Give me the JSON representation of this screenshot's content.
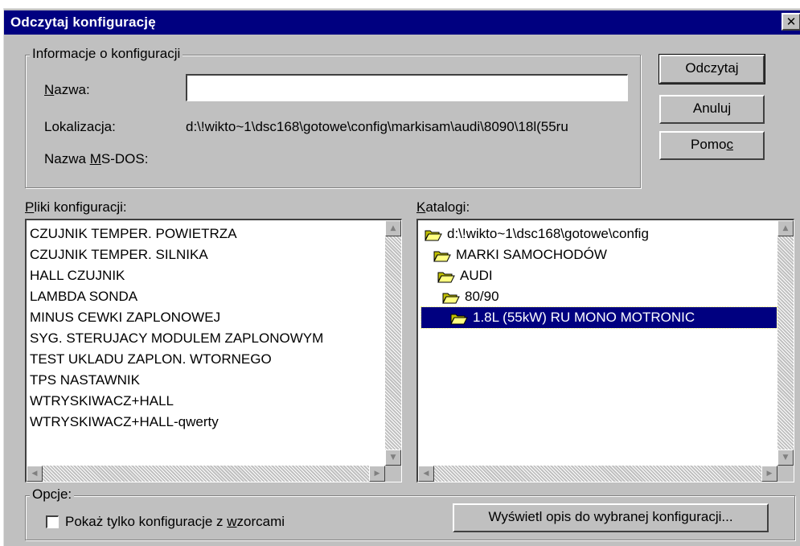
{
  "dialog": {
    "title": "Odczytaj konfigurację",
    "close_glyph": "✕"
  },
  "info_group": {
    "legend": "Informacje o konfiguracji",
    "name_label_u": "N",
    "name_label_rest": "azwa:",
    "name_value": "",
    "location_label": "Lokalizacja:",
    "location_value": "d:\\!wikto~1\\dsc168\\gotowe\\config\\markisam\\audi\\8090\\18l(55ru",
    "msdos_label_pre": "Nazwa ",
    "msdos_label_u": "M",
    "msdos_label_rest": "S-DOS:",
    "msdos_value": ""
  },
  "buttons": {
    "read": "Odczytaj",
    "cancel": "Anuluj",
    "help_pre": "Pomo",
    "help_u": "c"
  },
  "files": {
    "label_u": "P",
    "label_rest": "liki konfiguracji:",
    "items": [
      "CZUJNIK TEMPER. POWIETRZA",
      "CZUJNIK TEMPER. SILNIKA",
      "HALL CZUJNIK",
      "LAMBDA SONDA",
      "MINUS CEWKI ZAPLONOWEJ",
      "SYG. STERUJACY MODULEM ZAPLONOWYM",
      "TEST  UKLADU  ZAPLON. WTORNEGO",
      "TPS NASTAWNIK",
      "WTRYSKIWACZ+HALL",
      "WTRYSKIWACZ+HALL-qwerty"
    ]
  },
  "dirs": {
    "label_u": "K",
    "label_rest": "atalogi:",
    "items": [
      "d:\\!wikto~1\\dsc168\\gotowe\\config",
      "MARKI SAMOCHODÓW",
      "AUDI",
      "80/90",
      "1.8L (55kW)  RU   MONO MOTRONIC"
    ],
    "selected_index": 4
  },
  "options": {
    "legend": "Opcje:",
    "checkbox_pre": "Pokaż tylko konfiguracje z ",
    "checkbox_u": "w",
    "checkbox_rest": "zorcami",
    "show_description_button": "Wyświetl opis do wybranej konfiguracji..."
  },
  "icons": {
    "scroll_up": "▲",
    "scroll_down": "▼",
    "scroll_left": "◀",
    "scroll_right": "▶"
  },
  "colors": {
    "title_bar": "#000080",
    "face": "#c0c0c0",
    "selection": "#000080"
  }
}
